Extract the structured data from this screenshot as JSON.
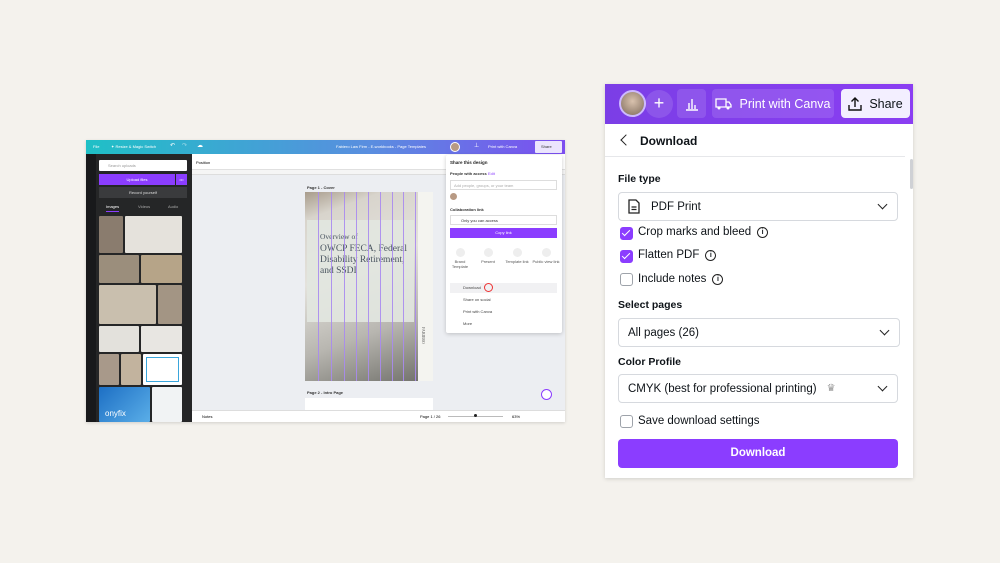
{
  "editor": {
    "menu": {
      "file": "File",
      "resize": "✦ Resize & Magic Switch"
    },
    "doc_title": "Fabiero Law Firm - E-workbooks - Page Templates",
    "print_label": "Print with Canva",
    "share_label": "Share",
    "search_placeholder": "Search uploads",
    "upload_label": "Upload files",
    "more_label": "•••",
    "record_label": "Record yourself",
    "tabs": [
      "Images",
      "Videos",
      "Audio"
    ],
    "toolbar_position": "Position",
    "page1_label": "Page 1 - Cover",
    "page2_label": "Page 2 - Intro Page",
    "cover_text": {
      "line1": "Overview of",
      "line2": "OWCP FECA, Federal Disability Retirement, and SSDI"
    },
    "side_text": "FABIERO",
    "thumb_logo_text": "onyfix",
    "notes_label": "Notes",
    "page_counter": "Page 1 / 26",
    "zoom": "63%",
    "share_menu": {
      "title": "Share this design",
      "people_label": "People with access",
      "edit": "Edit",
      "people_placeholder": "Add people, groups, or your team",
      "collab_label": "Collaboration link",
      "collab_value": "Only you can access",
      "copy_link": "Copy link",
      "options": [
        "Brand Template",
        "Present",
        "Template link",
        "Public view link"
      ],
      "items": [
        "Download",
        "Share on social",
        "Print with Canva",
        "More"
      ]
    }
  },
  "panel": {
    "header": {
      "print_label": "Print with Canva",
      "share_label": "Share"
    },
    "title": "Download",
    "file_type_label": "File type",
    "file_type_value": "PDF Print",
    "checkboxes": [
      {
        "label": "Crop marks and bleed",
        "checked": true
      },
      {
        "label": "Flatten PDF",
        "checked": true
      },
      {
        "label": "Include notes",
        "checked": false
      }
    ],
    "select_pages_label": "Select pages",
    "select_pages_value": "All pages (26)",
    "color_profile_label": "Color Profile",
    "color_profile_value": "CMYK (best for professional printing)",
    "save_settings": {
      "label": "Save download settings",
      "checked": false
    },
    "download_button": "Download"
  },
  "colors": {
    "accent": "#8b3dff",
    "header_start": "#7b3ee6",
    "background": "#f4f2ed"
  }
}
